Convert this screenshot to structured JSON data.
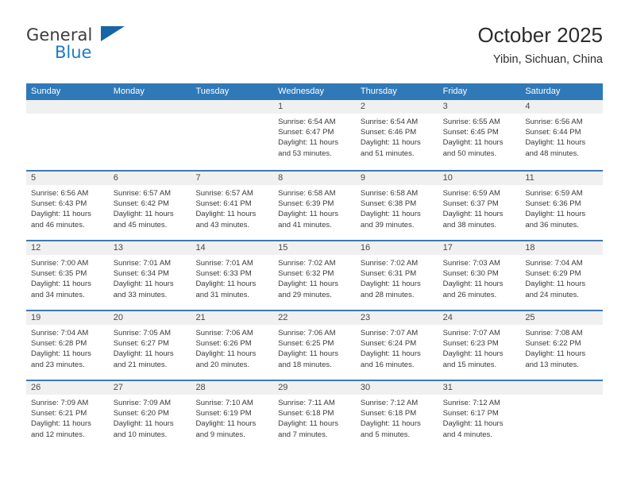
{
  "brand": {
    "name_line1": "General",
    "name_line2": "Blue",
    "logo_icon": "triangle-flag-icon",
    "accent_color": "#1f7ac4"
  },
  "header": {
    "title": "October 2025",
    "subtitle": "Yibin, Sichuan, China"
  },
  "calendar": {
    "header_color": "#3079b8",
    "row_divider_color": "#3d7ab3",
    "daynum_band_color": "#f0f0f0",
    "weekdays": [
      "Sunday",
      "Monday",
      "Tuesday",
      "Wednesday",
      "Thursday",
      "Friday",
      "Saturday"
    ],
    "labels": {
      "sunrise": "Sunrise:",
      "sunset": "Sunset:",
      "daylight": "Daylight:"
    },
    "weeks": [
      [
        {
          "day": ""
        },
        {
          "day": ""
        },
        {
          "day": ""
        },
        {
          "day": "1",
          "sunrise": "Sunrise: 6:54 AM",
          "sunset": "Sunset: 6:47 PM",
          "daylight": "Daylight: 11 hours and 53 minutes."
        },
        {
          "day": "2",
          "sunrise": "Sunrise: 6:54 AM",
          "sunset": "Sunset: 6:46 PM",
          "daylight": "Daylight: 11 hours and 51 minutes."
        },
        {
          "day": "3",
          "sunrise": "Sunrise: 6:55 AM",
          "sunset": "Sunset: 6:45 PM",
          "daylight": "Daylight: 11 hours and 50 minutes."
        },
        {
          "day": "4",
          "sunrise": "Sunrise: 6:56 AM",
          "sunset": "Sunset: 6:44 PM",
          "daylight": "Daylight: 11 hours and 48 minutes."
        }
      ],
      [
        {
          "day": "5",
          "sunrise": "Sunrise: 6:56 AM",
          "sunset": "Sunset: 6:43 PM",
          "daylight": "Daylight: 11 hours and 46 minutes."
        },
        {
          "day": "6",
          "sunrise": "Sunrise: 6:57 AM",
          "sunset": "Sunset: 6:42 PM",
          "daylight": "Daylight: 11 hours and 45 minutes."
        },
        {
          "day": "7",
          "sunrise": "Sunrise: 6:57 AM",
          "sunset": "Sunset: 6:41 PM",
          "daylight": "Daylight: 11 hours and 43 minutes."
        },
        {
          "day": "8",
          "sunrise": "Sunrise: 6:58 AM",
          "sunset": "Sunset: 6:39 PM",
          "daylight": "Daylight: 11 hours and 41 minutes."
        },
        {
          "day": "9",
          "sunrise": "Sunrise: 6:58 AM",
          "sunset": "Sunset: 6:38 PM",
          "daylight": "Daylight: 11 hours and 39 minutes."
        },
        {
          "day": "10",
          "sunrise": "Sunrise: 6:59 AM",
          "sunset": "Sunset: 6:37 PM",
          "daylight": "Daylight: 11 hours and 38 minutes."
        },
        {
          "day": "11",
          "sunrise": "Sunrise: 6:59 AM",
          "sunset": "Sunset: 6:36 PM",
          "daylight": "Daylight: 11 hours and 36 minutes."
        }
      ],
      [
        {
          "day": "12",
          "sunrise": "Sunrise: 7:00 AM",
          "sunset": "Sunset: 6:35 PM",
          "daylight": "Daylight: 11 hours and 34 minutes."
        },
        {
          "day": "13",
          "sunrise": "Sunrise: 7:01 AM",
          "sunset": "Sunset: 6:34 PM",
          "daylight": "Daylight: 11 hours and 33 minutes."
        },
        {
          "day": "14",
          "sunrise": "Sunrise: 7:01 AM",
          "sunset": "Sunset: 6:33 PM",
          "daylight": "Daylight: 11 hours and 31 minutes."
        },
        {
          "day": "15",
          "sunrise": "Sunrise: 7:02 AM",
          "sunset": "Sunset: 6:32 PM",
          "daylight": "Daylight: 11 hours and 29 minutes."
        },
        {
          "day": "16",
          "sunrise": "Sunrise: 7:02 AM",
          "sunset": "Sunset: 6:31 PM",
          "daylight": "Daylight: 11 hours and 28 minutes."
        },
        {
          "day": "17",
          "sunrise": "Sunrise: 7:03 AM",
          "sunset": "Sunset: 6:30 PM",
          "daylight": "Daylight: 11 hours and 26 minutes."
        },
        {
          "day": "18",
          "sunrise": "Sunrise: 7:04 AM",
          "sunset": "Sunset: 6:29 PM",
          "daylight": "Daylight: 11 hours and 24 minutes."
        }
      ],
      [
        {
          "day": "19",
          "sunrise": "Sunrise: 7:04 AM",
          "sunset": "Sunset: 6:28 PM",
          "daylight": "Daylight: 11 hours and 23 minutes."
        },
        {
          "day": "20",
          "sunrise": "Sunrise: 7:05 AM",
          "sunset": "Sunset: 6:27 PM",
          "daylight": "Daylight: 11 hours and 21 minutes."
        },
        {
          "day": "21",
          "sunrise": "Sunrise: 7:06 AM",
          "sunset": "Sunset: 6:26 PM",
          "daylight": "Daylight: 11 hours and 20 minutes."
        },
        {
          "day": "22",
          "sunrise": "Sunrise: 7:06 AM",
          "sunset": "Sunset: 6:25 PM",
          "daylight": "Daylight: 11 hours and 18 minutes."
        },
        {
          "day": "23",
          "sunrise": "Sunrise: 7:07 AM",
          "sunset": "Sunset: 6:24 PM",
          "daylight": "Daylight: 11 hours and 16 minutes."
        },
        {
          "day": "24",
          "sunrise": "Sunrise: 7:07 AM",
          "sunset": "Sunset: 6:23 PM",
          "daylight": "Daylight: 11 hours and 15 minutes."
        },
        {
          "day": "25",
          "sunrise": "Sunrise: 7:08 AM",
          "sunset": "Sunset: 6:22 PM",
          "daylight": "Daylight: 11 hours and 13 minutes."
        }
      ],
      [
        {
          "day": "26",
          "sunrise": "Sunrise: 7:09 AM",
          "sunset": "Sunset: 6:21 PM",
          "daylight": "Daylight: 11 hours and 12 minutes."
        },
        {
          "day": "27",
          "sunrise": "Sunrise: 7:09 AM",
          "sunset": "Sunset: 6:20 PM",
          "daylight": "Daylight: 11 hours and 10 minutes."
        },
        {
          "day": "28",
          "sunrise": "Sunrise: 7:10 AM",
          "sunset": "Sunset: 6:19 PM",
          "daylight": "Daylight: 11 hours and 9 minutes."
        },
        {
          "day": "29",
          "sunrise": "Sunrise: 7:11 AM",
          "sunset": "Sunset: 6:18 PM",
          "daylight": "Daylight: 11 hours and 7 minutes."
        },
        {
          "day": "30",
          "sunrise": "Sunrise: 7:12 AM",
          "sunset": "Sunset: 6:18 PM",
          "daylight": "Daylight: 11 hours and 5 minutes."
        },
        {
          "day": "31",
          "sunrise": "Sunrise: 7:12 AM",
          "sunset": "Sunset: 6:17 PM",
          "daylight": "Daylight: 11 hours and 4 minutes."
        },
        {
          "day": ""
        }
      ]
    ]
  }
}
